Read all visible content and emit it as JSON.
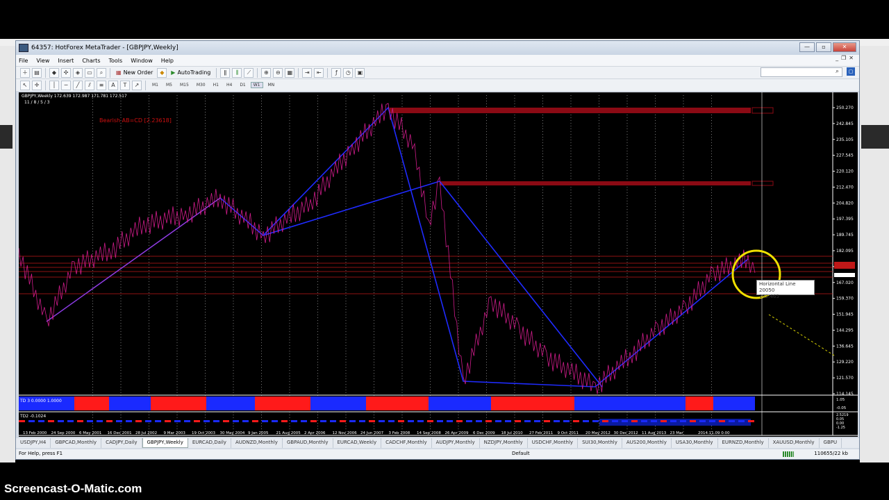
{
  "window": {
    "title": "64357: HotForex MetaTrader - [GBPJPY,Weekly]"
  },
  "menu": [
    "File",
    "View",
    "Insert",
    "Charts",
    "Tools",
    "Window",
    "Help"
  ],
  "toolbar": {
    "new_order_label": "New Order",
    "autotrading_label": "AutoTrading",
    "periods": [
      "M1",
      "M5",
      "M15",
      "M30",
      "H1",
      "H4",
      "D1",
      "W1",
      "MN"
    ],
    "active_period": "W1"
  },
  "chart": {
    "symbol_header": "GBPJPY,Weekly  172.639 172.987 171.781 172.517",
    "subheader": "11 / 8 / 5 / 3",
    "pattern_label": "Bearish AB=CD [2.23618]",
    "tooltip_line1": "Horizontal Line 20050",
    "tooltip_line2": "169.465",
    "price_ticks": [
      "250.270",
      "242.845",
      "235.105",
      "227.545",
      "220.120",
      "212.470",
      "204.820",
      "197.395",
      "189.745",
      "182.095",
      "174.670",
      "167.020",
      "159.370",
      "151.945",
      "144.295",
      "136.645",
      "129.220",
      "121.570",
      "114.145"
    ],
    "date_ticks": [
      "13 Feb 2000",
      "24 Sep 2000",
      "6 May 2001",
      "16 Dec 2001",
      "28 Jul 2002",
      "9 Mar 2003",
      "19 Oct 2003",
      "30 May 2004",
      "9 Jan 2005",
      "21 Aug 2005",
      "2 Apr 2006",
      "12 Nov 2006",
      "24 Jun 2007",
      "3 Feb 2008",
      "14 Sep 2008",
      "26 Apr 2009",
      "6 Dec 2009",
      "18 Jul 2010",
      "27 Feb 2011",
      "9 Oct 2011",
      "20 May 2012",
      "30 Dec 2012",
      "11 Aug 2013",
      "23 Mar",
      "2014.11.09 0:00"
    ],
    "indicator1_label": "TD 3  0.0000  1.0000",
    "indicator1_ticks": [
      "1.05",
      "-0.05"
    ],
    "indicator2_label": "TD2 -0.1024",
    "indicator2_ticks": [
      "2.5219",
      "0.05",
      "0.00",
      "-1.25"
    ]
  },
  "tabs": [
    "USDJPY,H4",
    "GBPCAD,Monthly",
    "CADJPY,Daily",
    "GBPJPY,Weekly",
    "EURCAD,Daily",
    "AUDNZD,Monthly",
    "GBPAUD,Monthly",
    "EURCAD,Weekly",
    "CADCHF,Monthly",
    "AUDJPY,Monthly",
    "NZDJPY,Monthly",
    "USDCHF,Monthly",
    "SUI30,Monthly",
    "AUS200,Monthly",
    "USA30,Monthly",
    "EURNZD,Monthly",
    "XAUUSD,Monthly",
    "GBPU"
  ],
  "active_tab": "GBPJPY,Weekly",
  "status": {
    "help": "For Help, press F1",
    "profile": "Default",
    "traffic": "110655/22 kb"
  },
  "watermark": "Screencast-O-Matic.com",
  "colors": {
    "chart_bg": "#000000",
    "candles": "#d01c8b",
    "pattern_lines": "#1f2bff",
    "zones": "#8b0a14",
    "highlight_circle": "#f0e000"
  }
}
